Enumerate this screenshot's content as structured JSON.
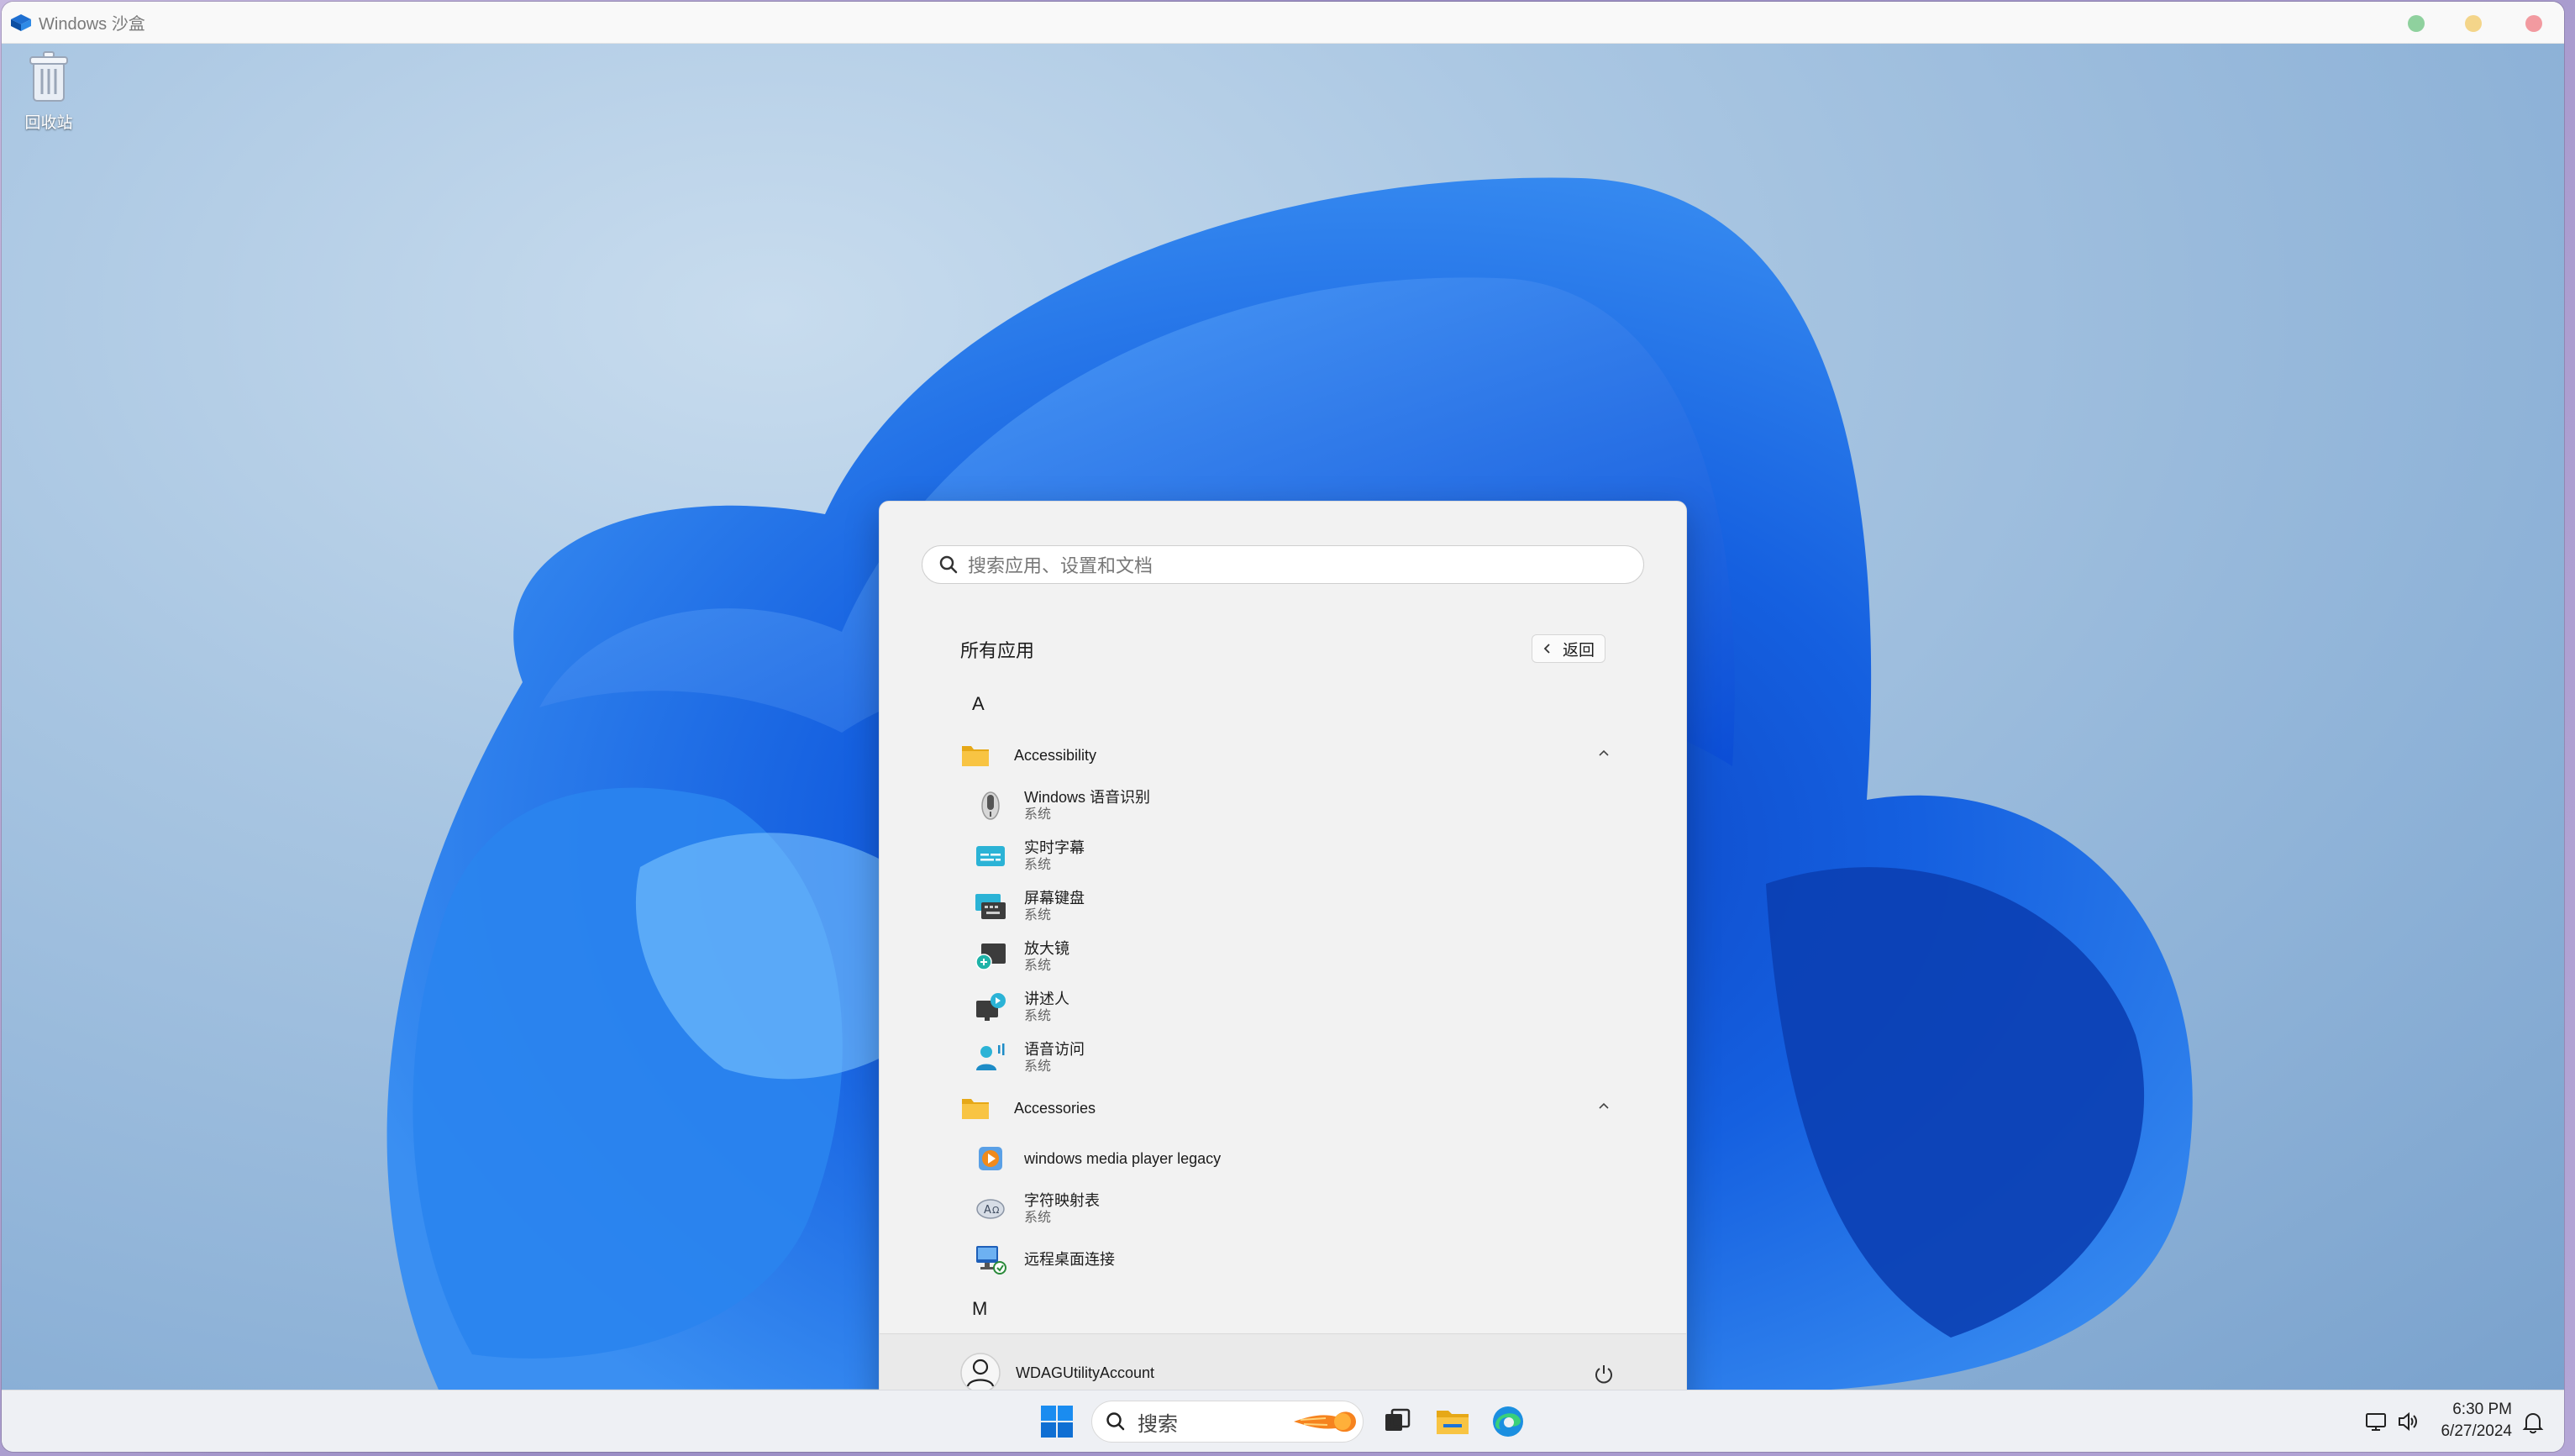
{
  "window": {
    "title": "Windows 沙盒",
    "logo_icon": "windows-sandbox-icon"
  },
  "desktop": {
    "icons": [
      {
        "label": "回收站",
        "icon": "recycle-bin-icon"
      }
    ]
  },
  "start_menu": {
    "search_placeholder": "搜索应用、设置和文档",
    "all_apps_title": "所有应用",
    "back_label": "返回",
    "groups": [
      {
        "letter": "A"
      },
      {
        "letter": "M"
      }
    ],
    "folders": [
      {
        "name": "Accessibility",
        "apps": [
          {
            "name": "Windows 语音识别",
            "sub": "系统",
            "icon": "microphone-icon"
          },
          {
            "name": "实时字幕",
            "sub": "系统",
            "icon": "live-captions-icon"
          },
          {
            "name": "屏幕键盘",
            "sub": "系统",
            "icon": "on-screen-keyboard-icon"
          },
          {
            "name": "放大镜",
            "sub": "系统",
            "icon": "magnifier-icon"
          },
          {
            "name": "讲述人",
            "sub": "系统",
            "icon": "narrator-icon"
          },
          {
            "name": "语音访问",
            "sub": "系统",
            "icon": "voice-access-icon"
          }
        ]
      },
      {
        "name": "Accessories",
        "apps": [
          {
            "name": "windows media player legacy",
            "sub": "",
            "icon": "media-player-icon"
          },
          {
            "name": "字符映射表",
            "sub": "系统",
            "icon": "character-map-icon"
          },
          {
            "name": "远程桌面连接",
            "sub": "",
            "icon": "remote-desktop-icon"
          }
        ]
      }
    ],
    "user": {
      "name": "WDAGUtilityAccount",
      "icon": "user-avatar-icon"
    },
    "power_icon": "power-icon"
  },
  "taskbar": {
    "search_label": "搜索",
    "clock": {
      "time": "6:30 PM",
      "date": "6/27/2024"
    },
    "icons": [
      "start-icon",
      "search-icon",
      "task-view-icon",
      "file-explorer-icon",
      "edge-icon",
      "network-icon",
      "volume-icon",
      "notification-icon"
    ]
  },
  "colors": {
    "accent": "#0067c0",
    "folder": "#f8c443"
  }
}
